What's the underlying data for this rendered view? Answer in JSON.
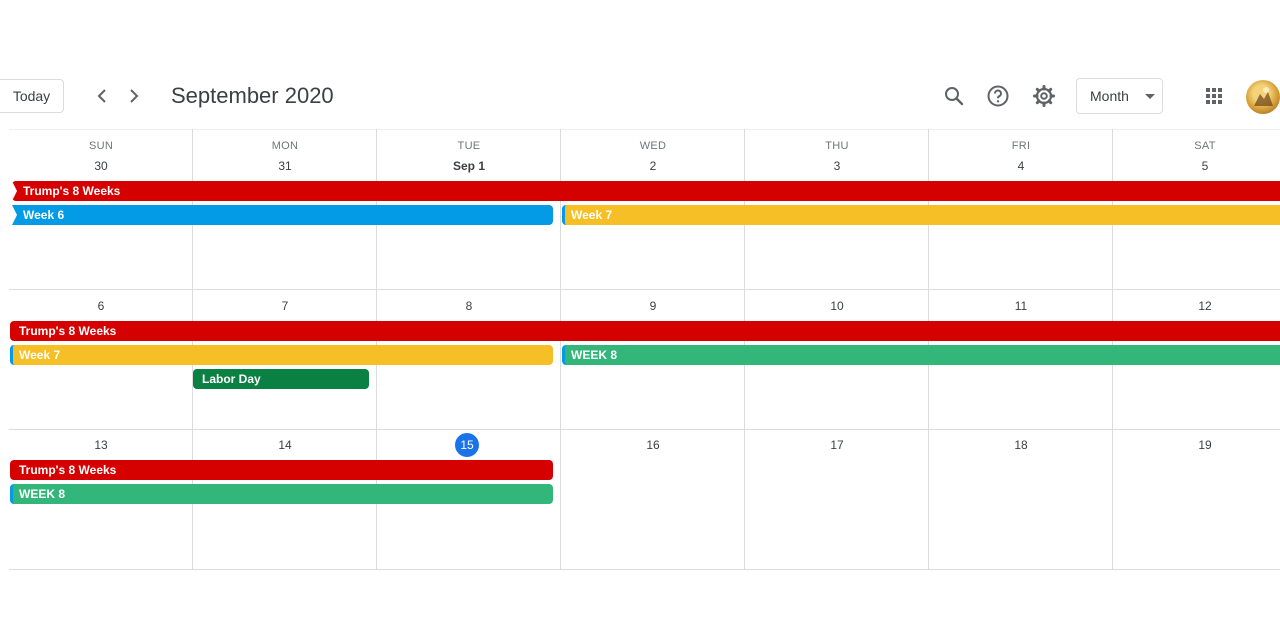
{
  "toolbar": {
    "today_label": "Today",
    "title": "September 2020",
    "view": "Month"
  },
  "weekdays": [
    "SUN",
    "MON",
    "TUE",
    "WED",
    "THU",
    "FRI",
    "SAT"
  ],
  "weeks": [
    {
      "days": [
        "30",
        "31",
        "Sep 1",
        "2",
        "3",
        "4",
        "5"
      ]
    },
    {
      "days": [
        "6",
        "7",
        "8",
        "9",
        "10",
        "11",
        "12"
      ]
    },
    {
      "days": [
        "13",
        "14",
        "15",
        "16",
        "17",
        "18",
        "19"
      ]
    }
  ],
  "today": "15",
  "events": {
    "w1_trump": "Trump's 8 Weeks",
    "w1_week6": "Week 6",
    "w1_week7": "Week 7",
    "w2_trump": "Trump's 8 Weeks",
    "w2_week7": "Week 7",
    "w2_week8": "WEEK 8",
    "w2_labor": "Labor Day",
    "w3_trump": "Trump's 8 Weeks",
    "w3_week8": "WEEK 8"
  },
  "colors": {
    "red": "#d50000",
    "blue": "#039be5",
    "yellow": "#f6bf26",
    "green": "#33b679",
    "dark_green": "#0b8043",
    "today": "#1a73e8"
  }
}
